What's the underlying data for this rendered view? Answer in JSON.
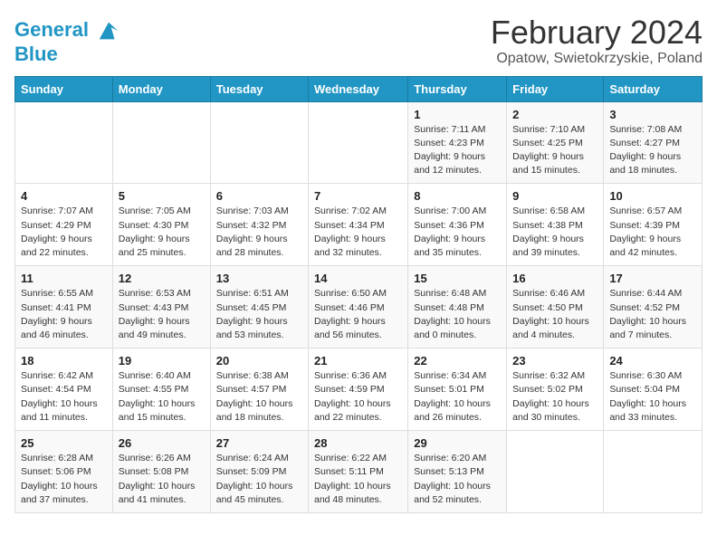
{
  "header": {
    "logo_line1": "General",
    "logo_line2": "Blue",
    "title": "February 2024",
    "subtitle": "Opatow, Swietokrzyskie, Poland"
  },
  "weekdays": [
    "Sunday",
    "Monday",
    "Tuesday",
    "Wednesday",
    "Thursday",
    "Friday",
    "Saturday"
  ],
  "weeks": [
    [
      {
        "day": "",
        "info": ""
      },
      {
        "day": "",
        "info": ""
      },
      {
        "day": "",
        "info": ""
      },
      {
        "day": "",
        "info": ""
      },
      {
        "day": "1",
        "info": "Sunrise: 7:11 AM\nSunset: 4:23 PM\nDaylight: 9 hours\nand 12 minutes."
      },
      {
        "day": "2",
        "info": "Sunrise: 7:10 AM\nSunset: 4:25 PM\nDaylight: 9 hours\nand 15 minutes."
      },
      {
        "day": "3",
        "info": "Sunrise: 7:08 AM\nSunset: 4:27 PM\nDaylight: 9 hours\nand 18 minutes."
      }
    ],
    [
      {
        "day": "4",
        "info": "Sunrise: 7:07 AM\nSunset: 4:29 PM\nDaylight: 9 hours\nand 22 minutes."
      },
      {
        "day": "5",
        "info": "Sunrise: 7:05 AM\nSunset: 4:30 PM\nDaylight: 9 hours\nand 25 minutes."
      },
      {
        "day": "6",
        "info": "Sunrise: 7:03 AM\nSunset: 4:32 PM\nDaylight: 9 hours\nand 28 minutes."
      },
      {
        "day": "7",
        "info": "Sunrise: 7:02 AM\nSunset: 4:34 PM\nDaylight: 9 hours\nand 32 minutes."
      },
      {
        "day": "8",
        "info": "Sunrise: 7:00 AM\nSunset: 4:36 PM\nDaylight: 9 hours\nand 35 minutes."
      },
      {
        "day": "9",
        "info": "Sunrise: 6:58 AM\nSunset: 4:38 PM\nDaylight: 9 hours\nand 39 minutes."
      },
      {
        "day": "10",
        "info": "Sunrise: 6:57 AM\nSunset: 4:39 PM\nDaylight: 9 hours\nand 42 minutes."
      }
    ],
    [
      {
        "day": "11",
        "info": "Sunrise: 6:55 AM\nSunset: 4:41 PM\nDaylight: 9 hours\nand 46 minutes."
      },
      {
        "day": "12",
        "info": "Sunrise: 6:53 AM\nSunset: 4:43 PM\nDaylight: 9 hours\nand 49 minutes."
      },
      {
        "day": "13",
        "info": "Sunrise: 6:51 AM\nSunset: 4:45 PM\nDaylight: 9 hours\nand 53 minutes."
      },
      {
        "day": "14",
        "info": "Sunrise: 6:50 AM\nSunset: 4:46 PM\nDaylight: 9 hours\nand 56 minutes."
      },
      {
        "day": "15",
        "info": "Sunrise: 6:48 AM\nSunset: 4:48 PM\nDaylight: 10 hours\nand 0 minutes."
      },
      {
        "day": "16",
        "info": "Sunrise: 6:46 AM\nSunset: 4:50 PM\nDaylight: 10 hours\nand 4 minutes."
      },
      {
        "day": "17",
        "info": "Sunrise: 6:44 AM\nSunset: 4:52 PM\nDaylight: 10 hours\nand 7 minutes."
      }
    ],
    [
      {
        "day": "18",
        "info": "Sunrise: 6:42 AM\nSunset: 4:54 PM\nDaylight: 10 hours\nand 11 minutes."
      },
      {
        "day": "19",
        "info": "Sunrise: 6:40 AM\nSunset: 4:55 PM\nDaylight: 10 hours\nand 15 minutes."
      },
      {
        "day": "20",
        "info": "Sunrise: 6:38 AM\nSunset: 4:57 PM\nDaylight: 10 hours\nand 18 minutes."
      },
      {
        "day": "21",
        "info": "Sunrise: 6:36 AM\nSunset: 4:59 PM\nDaylight: 10 hours\nand 22 minutes."
      },
      {
        "day": "22",
        "info": "Sunrise: 6:34 AM\nSunset: 5:01 PM\nDaylight: 10 hours\nand 26 minutes."
      },
      {
        "day": "23",
        "info": "Sunrise: 6:32 AM\nSunset: 5:02 PM\nDaylight: 10 hours\nand 30 minutes."
      },
      {
        "day": "24",
        "info": "Sunrise: 6:30 AM\nSunset: 5:04 PM\nDaylight: 10 hours\nand 33 minutes."
      }
    ],
    [
      {
        "day": "25",
        "info": "Sunrise: 6:28 AM\nSunset: 5:06 PM\nDaylight: 10 hours\nand 37 minutes."
      },
      {
        "day": "26",
        "info": "Sunrise: 6:26 AM\nSunset: 5:08 PM\nDaylight: 10 hours\nand 41 minutes."
      },
      {
        "day": "27",
        "info": "Sunrise: 6:24 AM\nSunset: 5:09 PM\nDaylight: 10 hours\nand 45 minutes."
      },
      {
        "day": "28",
        "info": "Sunrise: 6:22 AM\nSunset: 5:11 PM\nDaylight: 10 hours\nand 48 minutes."
      },
      {
        "day": "29",
        "info": "Sunrise: 6:20 AM\nSunset: 5:13 PM\nDaylight: 10 hours\nand 52 minutes."
      },
      {
        "day": "",
        "info": ""
      },
      {
        "day": "",
        "info": ""
      }
    ]
  ]
}
